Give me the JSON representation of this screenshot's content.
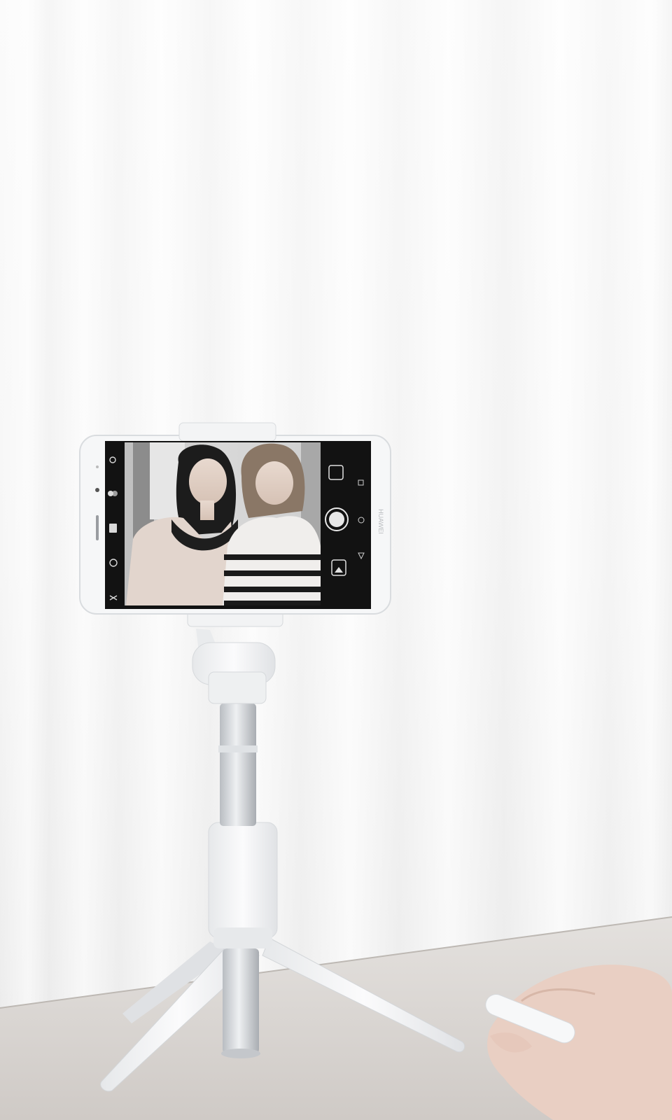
{
  "scene": {
    "description_free": true,
    "phone": {
      "brand_text": "HUAWEI"
    },
    "colors": {
      "curtain": "#f6f6f6",
      "table": "#d9d6d2",
      "device_white": "#f4f5f6",
      "pole_metal": "#c9ccd0",
      "screen_dark": "#111111"
    }
  }
}
